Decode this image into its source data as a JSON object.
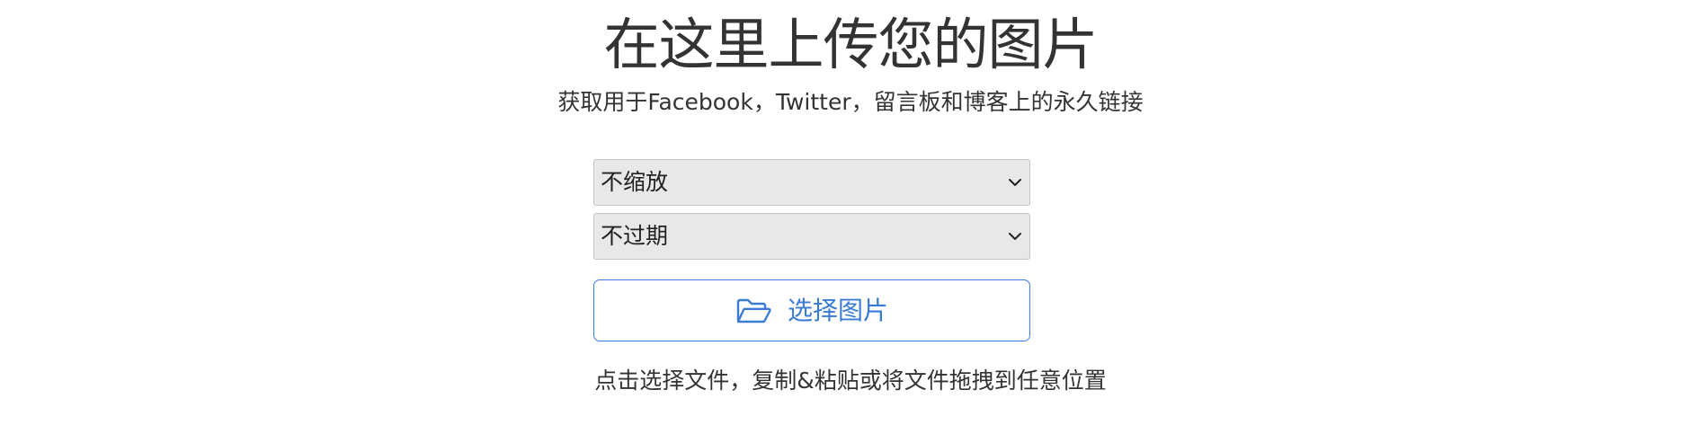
{
  "header": {
    "title": "在这里上传您的图片",
    "subtitle": "获取用于Facebook，Twitter，留言板和博客上的永久链接"
  },
  "form": {
    "resize_select": {
      "selected": "不缩放"
    },
    "expire_select": {
      "selected": "不过期"
    },
    "choose_button": {
      "label": "选择图片",
      "icon": "folder-open-icon"
    },
    "hint": "点击选择文件，复制&粘贴或将文件拖拽到任意位置"
  },
  "colors": {
    "accent": "#3a7bd5",
    "select_background": "#e8e8e8",
    "text": "#333333"
  }
}
